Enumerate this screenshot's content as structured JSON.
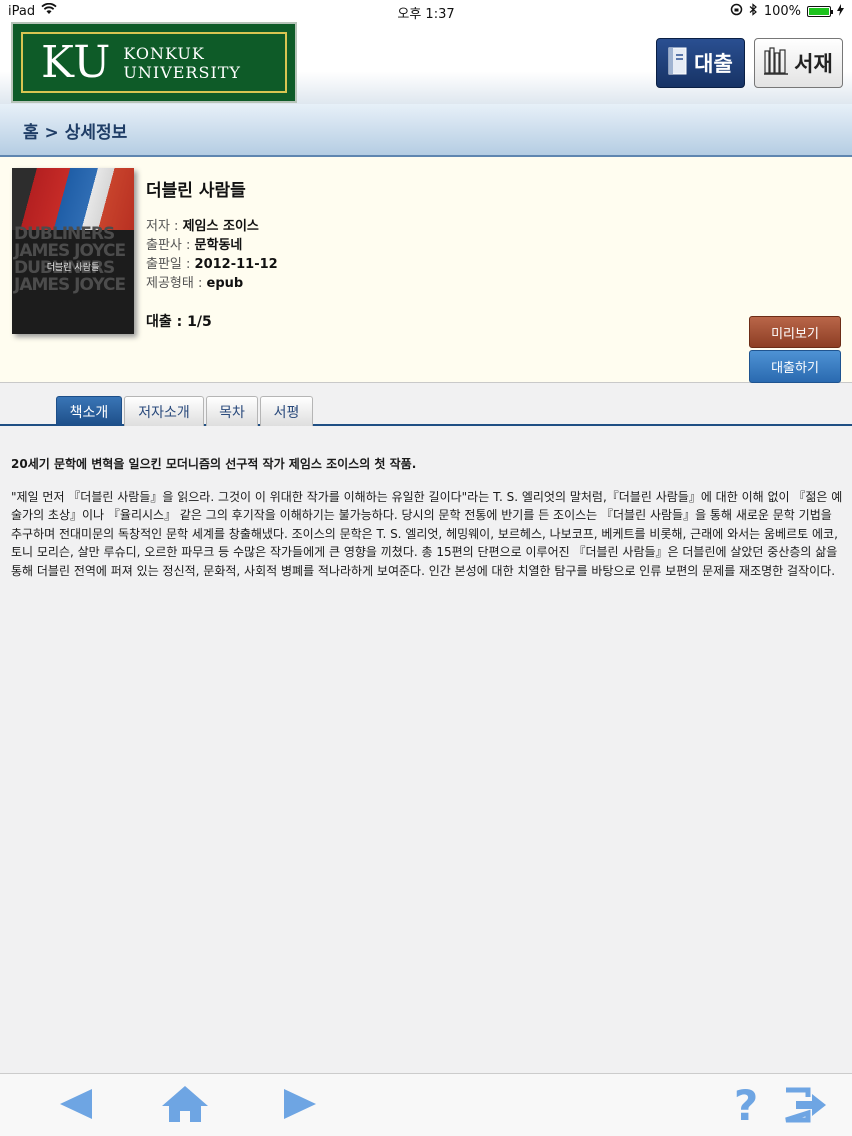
{
  "status_bar": {
    "device": "iPad",
    "time": "오후 1:37",
    "battery_text": "100%",
    "battery_level": 1.0
  },
  "header": {
    "logo_initials": "KU",
    "logo_line1": "KONKUK",
    "logo_line2": "UNIVERSITY",
    "loan_button": "대출",
    "shelf_button": "서재"
  },
  "breadcrumb": "홈 > 상세정보",
  "book": {
    "title": "더블린 사람들",
    "cover_words": [
      "DUBLINERS",
      "JAMES JOYCE",
      "DUBLINERS",
      "JAMES JOYCE"
    ],
    "cover_title": "더블린 사람들",
    "author_label": "저자 : ",
    "author": "제임스 조이스",
    "publisher_label": "출판사 : ",
    "publisher": "문학동네",
    "pubdate_label": "출판일 : ",
    "pubdate": "2012-11-12",
    "format_label": "제공형태 : ",
    "format": "epub",
    "loan_status": "대출 : 1/5",
    "preview_button": "미리보기",
    "borrow_button": "대출하기"
  },
  "tabs": [
    "책소개",
    "저자소개",
    "목차",
    "서평"
  ],
  "active_tab": "책소개",
  "description": {
    "lead": "20세기 문학에 변혁을 일으킨 모더니즘의 선구적 작가 제임스 조이스의 첫 작품.",
    "body": "\"제일 먼저 『더블린 사람들』을 읽으라. 그것이 이 위대한 작가를 이해하는 유일한 길이다\"라는 T. S. 엘리엇의 말처럼,『더블린 사람들』에 대한 이해 없이 『젊은 예술가의 초상』이나 『율리시스』 같은 그의 후기작을 이해하기는 불가능하다. 당시의 문학 전통에 반기를 든 조이스는 『더블린 사람들』을 통해 새로운 문학 기법을 추구하며 전대미문의 독창적인 문학 세계를 창출해냈다. 조이스의 문학은 T. S. 엘리엇, 헤밍웨이, 보르헤스, 나보코프, 베케트를 비롯해, 근래에 와서는 움베르토 에코, 토니 모리슨, 살만 루슈디, 오르한 파무크 등 수많은 작가들에게 큰 영향을 끼쳤다. 총 15편의 단편으로 이루어진 『더블린 사람들』은 더블린에 살았던 중산층의 삶을 통해 더블린 전역에 퍼져 있는 정신적, 문화적, 사회적 병폐를 적나라하게 보여준다. 인간 본성에 대한 치열한 탐구를 바탕으로 인류 보편의 문제를 재조명한 걸작이다."
  },
  "toolbar": {
    "icons": [
      "back-arrow-icon",
      "home-icon",
      "forward-arrow-icon",
      "help-icon",
      "logout-icon"
    ],
    "accent_color": "#6ea5e3"
  },
  "colors": {
    "logo_green": "#0e5b28",
    "logo_border_gold": "#d8c552",
    "loan_button_navy": "#173365",
    "preview_brown": "#8d3e24",
    "borrow_blue": "#2a6ab0",
    "tab_active_blue": "#1d4e88"
  }
}
